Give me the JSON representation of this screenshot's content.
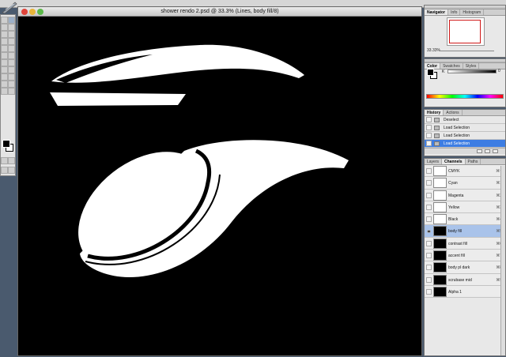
{
  "document": {
    "title": "shower rendo 2.psd @ 33.3% (Lines, body fill/8)"
  },
  "navigator": {
    "tabs": [
      "Navigator",
      "Info",
      "Histogram"
    ],
    "zoom": "33.33%"
  },
  "color": {
    "tabs": [
      "Color",
      "Swatches",
      "Styles"
    ],
    "channel_label": "K",
    "channel_value": "0"
  },
  "history": {
    "tabs": [
      "History",
      "Actions"
    ],
    "items": [
      {
        "label": "Deselect"
      },
      {
        "label": "Load Selection"
      },
      {
        "label": "Load Selection"
      },
      {
        "label": "Load Selection"
      }
    ]
  },
  "channels": {
    "tabs": [
      "Layers",
      "Channels",
      "Paths"
    ],
    "items": [
      {
        "label": "CMYK",
        "key": "⌘~"
      },
      {
        "label": "Cyan",
        "key": "⌘1"
      },
      {
        "label": "Magenta",
        "key": "⌘2"
      },
      {
        "label": "Yellow",
        "key": "⌘3"
      },
      {
        "label": "Black",
        "key": "⌘4"
      },
      {
        "label": "body fill",
        "key": "⌘5"
      },
      {
        "label": "contrast fill",
        "key": "⌘6"
      },
      {
        "label": "accent fill",
        "key": "⌘7"
      },
      {
        "label": "body pl dark",
        "key": "⌘8"
      },
      {
        "label": "scrubase mid",
        "key": "⌘9"
      },
      {
        "label": "Alpha 1",
        "key": ""
      }
    ]
  },
  "colors": {
    "selection_blue": "#3d7de3",
    "navigator_frame": "#d01818"
  }
}
